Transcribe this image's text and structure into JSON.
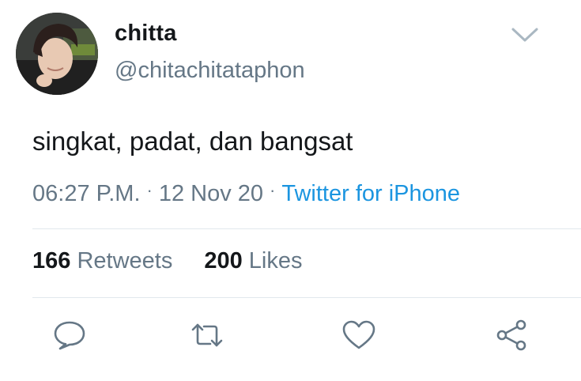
{
  "user": {
    "display_name": "chitta",
    "handle": "@chitachitataphon",
    "avatar_icon": "profile-photo"
  },
  "tweet": {
    "text": "singkat, padat, dan bangsat",
    "time": "06:27 P.M.",
    "date": "12 Nov 20",
    "separator": "·",
    "source": "Twitter for iPhone"
  },
  "stats": {
    "retweets_count": "166",
    "retweets_label": "Retweets",
    "likes_count": "200",
    "likes_label": "Likes"
  },
  "actions": {
    "reply_icon": "speech-bubble-icon",
    "retweet_icon": "retweet-arrows-icon",
    "like_icon": "heart-icon",
    "share_icon": "share-nodes-icon"
  },
  "colors": {
    "text_primary": "#14171a",
    "text_secondary": "#657786",
    "link": "#1b95e0",
    "divider": "#e1e8ed",
    "icon": "#657786"
  }
}
